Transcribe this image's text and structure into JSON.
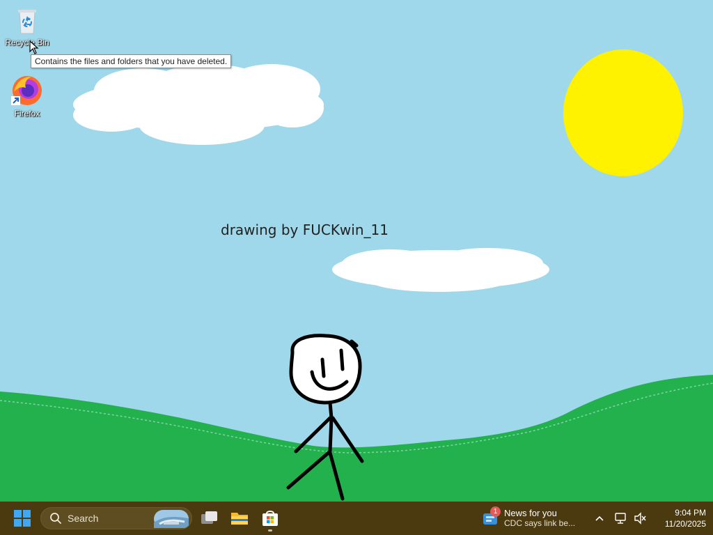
{
  "desktop": {
    "icons": [
      {
        "label": "Recycle Bin",
        "icon": "recycle-bin-icon"
      },
      {
        "label": "Firefox",
        "icon": "firefox-icon"
      }
    ],
    "tooltip": "Contains the files and folders that you have deleted.",
    "wallpaper_text": "drawing by FUCKwin_11"
  },
  "taskbar": {
    "search_placeholder": "Search",
    "apps": [
      {
        "name": "Task View",
        "icon": "task-view-icon"
      },
      {
        "name": "File Explorer",
        "icon": "folder-icon"
      },
      {
        "name": "Microsoft Store",
        "icon": "store-icon",
        "active": true
      }
    ],
    "news": {
      "badge": "1",
      "title": "News for you",
      "subtitle": "CDC says link be..."
    },
    "clock": {
      "time": "9:04 PM",
      "date": "11/20/2025"
    }
  },
  "colors": {
    "sky": "#9fd8ea",
    "grass": "#22b14c",
    "sun": "#fff200",
    "taskbar": "#4b3a10"
  }
}
